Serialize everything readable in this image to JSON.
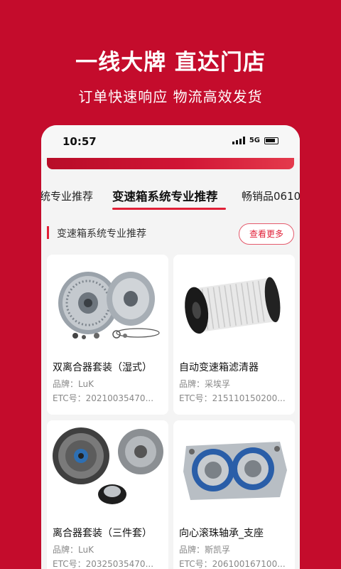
{
  "promo": {
    "title": "一线大牌 直达门店",
    "subtitle": "订单快速响应 物流高效发货"
  },
  "status_bar": {
    "time": "10:57",
    "network": "5G"
  },
  "tabs": [
    {
      "label": "统专业推荐"
    },
    {
      "label": "变速箱系统专业推荐",
      "active": true
    },
    {
      "label": "畅销品0610"
    }
  ],
  "section": {
    "title": "变速箱系统专业推荐",
    "more_label": "查看更多"
  },
  "products": [
    {
      "name": "双离合器套装（湿式）",
      "brand": "品牌：LuK",
      "etc": "ETC号：20210035470..."
    },
    {
      "name": "自动变速箱滤清器",
      "brand": "品牌：采埃孚",
      "etc": "ETC号：215110150200..."
    },
    {
      "name": "离合器套装（三件套）",
      "brand": "品牌：LuK",
      "etc": "ETC号：20325035470..."
    },
    {
      "name": "向心滚珠轴承_支座",
      "brand": "品牌：斯凯孚",
      "etc": "ETC号：206100167100..."
    }
  ],
  "colors": {
    "brand_red": "#c40c2c",
    "accent": "#e01f37"
  }
}
